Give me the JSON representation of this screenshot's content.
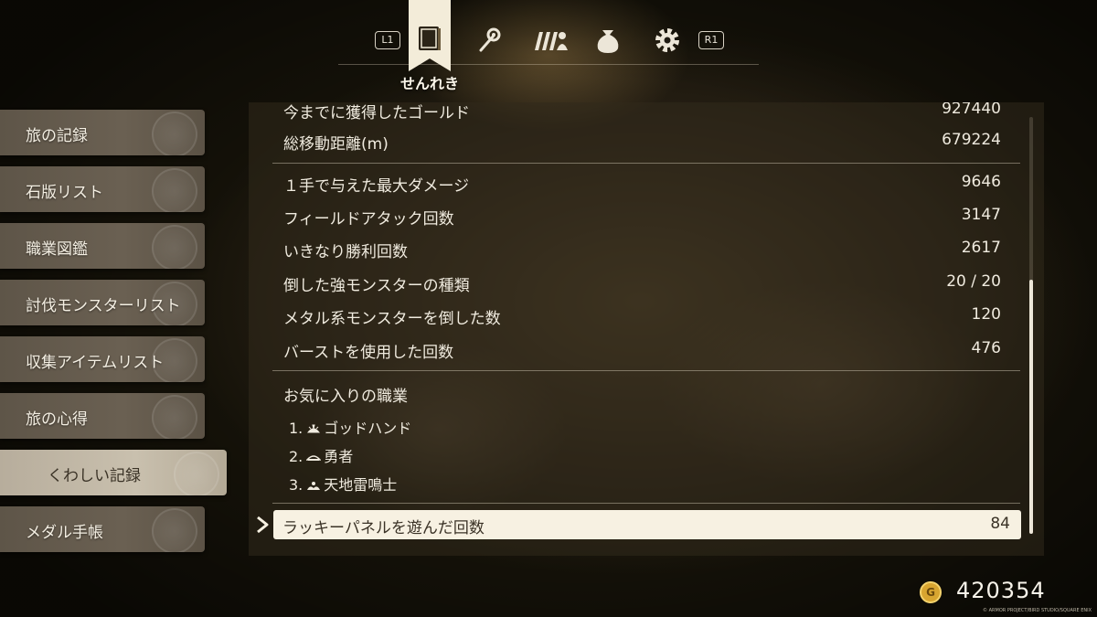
{
  "topbar": {
    "left_shoulder": "L1",
    "right_shoulder": "R1",
    "active_tab_label": "せんれき",
    "tabs": [
      {
        "icon": "book-icon",
        "active": true
      },
      {
        "icon": "staff-icon",
        "active": false
      },
      {
        "icon": "party-icon",
        "active": false
      },
      {
        "icon": "bag-icon",
        "active": false
      },
      {
        "icon": "gear-icon",
        "active": false
      }
    ]
  },
  "sidebar": {
    "items": [
      {
        "label": "旅の記録",
        "icon": "book-emblem-icon"
      },
      {
        "label": "石版リスト",
        "icon": "tablet-emblem-icon"
      },
      {
        "label": "職業図鑑",
        "icon": "swords-emblem-icon"
      },
      {
        "label": "討伐モンスターリスト",
        "icon": "monster-emblem-icon"
      },
      {
        "label": "収集アイテムリスト",
        "icon": "pouch-emblem-icon"
      },
      {
        "label": "旅の心得",
        "icon": "scroll-emblem-icon"
      },
      {
        "label": "くわしい記録",
        "icon": "quill-emblem-icon",
        "selected": true
      },
      {
        "label": "メダル手帳",
        "icon": "medal-emblem-icon"
      }
    ]
  },
  "stats": {
    "partial_top": {
      "label": "今までに獲得したゴールド",
      "value": "927440"
    },
    "group1": [
      {
        "label": "総移動距離(m)",
        "value": "679224"
      }
    ],
    "group2": [
      {
        "label": "１手で与えた最大ダメージ",
        "value": "9646"
      },
      {
        "label": "フィールドアタック回数",
        "value": "3147"
      },
      {
        "label": "いきなり勝利回数",
        "value": "2617"
      },
      {
        "label": "倒した強モンスターの種類",
        "value": "20 / 20"
      },
      {
        "label": "メタル系モンスターを倒した数",
        "value": "120"
      },
      {
        "label": "バーストを使用した回数",
        "value": "476"
      }
    ],
    "favorites": {
      "title": "お気に入りの職業",
      "items": [
        {
          "rank": "1.",
          "name": "ゴッドハンド",
          "icon": "godhand-job-icon"
        },
        {
          "rank": "2.",
          "name": "勇者",
          "icon": "hero-job-icon"
        },
        {
          "rank": "3.",
          "name": "天地雷鳴士",
          "icon": "summoner-job-icon"
        }
      ]
    },
    "selected": {
      "label": "ラッキーパネルを遊んだ回数",
      "value": "84"
    }
  },
  "gold": {
    "icon_letter": "G",
    "amount": "420354"
  },
  "copyright": "© ARMOR PROJECT/BIRD STUDIO/SQUARE ENIX",
  "colors": {
    "highlight": "#f7f1e2",
    "gold": "#d8a530",
    "panel": "#322a1c"
  }
}
